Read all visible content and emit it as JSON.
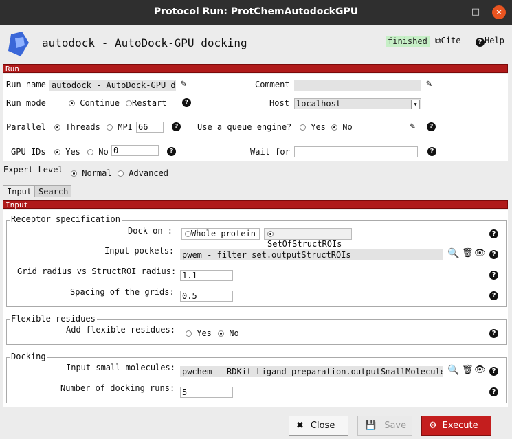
{
  "window": {
    "title": "Protocol Run: ProtChemAutodockGPU"
  },
  "header": {
    "title": "autodock - AutoDock-GPU docking",
    "status": "finished",
    "cite": "Cite",
    "help": "Help"
  },
  "run": {
    "section": "Run",
    "run_name_label": "Run name",
    "run_name_value": "autodock - AutoDock-GPU docking",
    "comment_label": "Comment",
    "comment_value": "",
    "run_mode_label": "Run mode",
    "run_mode_opt1": "Continue",
    "run_mode_opt2": "Restart",
    "host_label": "Host",
    "host_value": "localhost",
    "parallel_label": "Parallel",
    "parallel_opt1": "Threads",
    "parallel_opt2": "MPI",
    "mpi_value": "66",
    "queue_label": "Use a queue engine?",
    "queue_yes": "Yes",
    "queue_no": "No",
    "gpu_label": "GPU IDs",
    "gpu_yes": "Yes",
    "gpu_no": "No",
    "gpu_value": "0",
    "wait_label": "Wait for",
    "wait_value": ""
  },
  "expert": {
    "label": "Expert Level",
    "opt1": "Normal",
    "opt2": "Advanced"
  },
  "tabs": [
    "Input",
    "Search"
  ],
  "input": {
    "section": "Input",
    "receptor": {
      "title": "Receptor specification",
      "dock_on_label": "Dock on :",
      "dock_opt1": "Whole protein",
      "dock_opt2": "SetOfStructROIs",
      "pockets_label": "Input pockets:",
      "pockets_value": "pwem - filter set.outputStructROIs",
      "grid_label": "Grid radius vs StructROI radius:",
      "grid_value": "1.1",
      "spacing_label": "Spacing of the grids:",
      "spacing_value": "0.5"
    },
    "flexible": {
      "title": "Flexible residues",
      "label": "Add flexible residues:",
      "yes": "Yes",
      "no": "No"
    },
    "docking": {
      "title": "Docking",
      "mol_label": "Input small molecules:",
      "mol_value": "pwchem - RDKit Ligand preparation.outputSmallMolecules",
      "runs_label": "Number of docking runs:",
      "runs_value": "5"
    }
  },
  "buttons": {
    "close": "Close",
    "save": "Save",
    "execute": "Execute"
  },
  "colors": {
    "accent": "#b01a1a",
    "status_bg": "#c6efc6",
    "execute": "#c41e1e"
  }
}
